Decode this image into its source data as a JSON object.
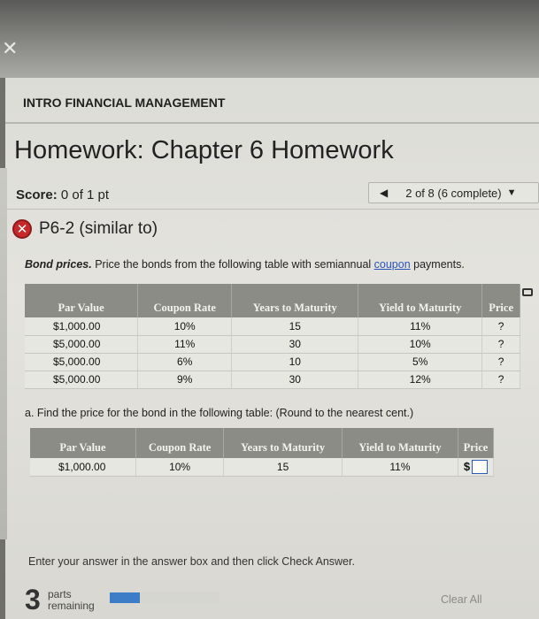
{
  "window": {
    "close_glyph": "✕"
  },
  "course": {
    "title": "INTRO FINANCIAL MANAGEMENT"
  },
  "homework": {
    "title": "Homework: Chapter 6 Homework"
  },
  "score": {
    "label": "Score:",
    "value": "0 of 1 pt"
  },
  "navigation": {
    "prev_glyph": "◀",
    "position_text": "2 of 8 (6 complete)",
    "menu_glyph": "▼"
  },
  "question": {
    "status_icon": "x-circle-icon",
    "status_color": "#c8282a",
    "title": "P6-2 (similar to)",
    "instruction_bold": "Bond prices.",
    "instruction_text": " Price the bonds from the following table with semiannual ",
    "instruction_link": "coupon",
    "instruction_end": " payments."
  },
  "table1": {
    "headers": [
      "Par Value",
      "Coupon Rate",
      "Years to Maturity",
      "Yield to Maturity",
      "Price"
    ],
    "rows": [
      [
        "$1,000.00",
        "10%",
        "15",
        "11%",
        "?"
      ],
      [
        "$5,000.00",
        "11%",
        "30",
        "10%",
        "?"
      ],
      [
        "$5,000.00",
        "6%",
        "10",
        "5%",
        "?"
      ],
      [
        "$5,000.00",
        "9%",
        "30",
        "12%",
        "?"
      ]
    ]
  },
  "part_a": {
    "text": "a. Find the price for the bond in the following table:  (Round to the nearest cent.)"
  },
  "table2": {
    "headers": [
      "Par Value",
      "Coupon Rate",
      "Years to Maturity",
      "Yield to Maturity",
      "Price"
    ],
    "row": [
      "$1,000.00",
      "10%",
      "15",
      "11%"
    ],
    "price_prefix": "$",
    "price_value": ""
  },
  "footer": {
    "instruction": "Enter your answer in the answer box and then click Check Answer.",
    "parts_count": "3",
    "parts_label": "parts remaining",
    "progress_fraction": 0.27,
    "progress_color": "#3d7cc6",
    "clear_label": "Clear All"
  }
}
